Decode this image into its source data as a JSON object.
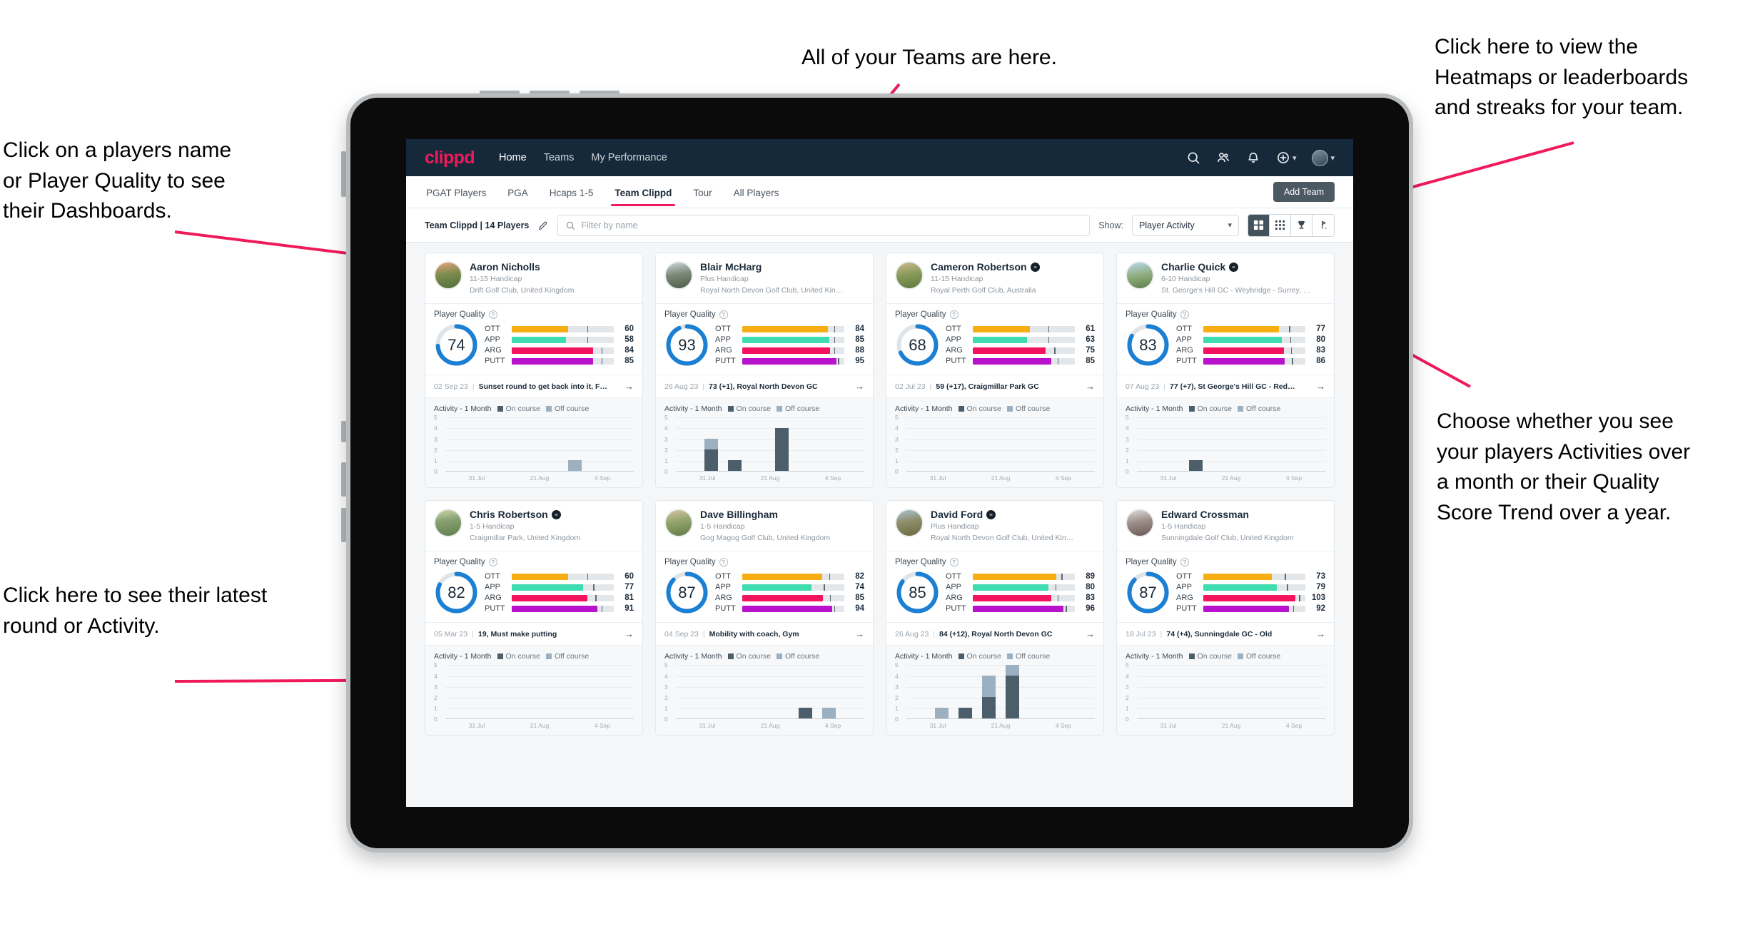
{
  "annotations": [
    {
      "id": "teams-note",
      "text": "All of your Teams are here."
    },
    {
      "id": "heatmaps-note",
      "text": "Click here to view the\nHeatmaps or leaderboards\nand streaks for your team."
    },
    {
      "id": "dashboard-note",
      "text": "Click on a players name\nor Player Quality to see\ntheir Dashboards."
    },
    {
      "id": "activity-note",
      "text": "Choose whether you see\nyour players Activities over\na month or their Quality\nScore Trend over a year."
    },
    {
      "id": "round-note",
      "text": "Click here to see their latest\nround or Activity."
    }
  ],
  "colors": {
    "accent": "#ef1a5b",
    "navbar": "#16293a",
    "ott": "#f6ae13",
    "app": "#3edcb0",
    "arg": "#f4135e",
    "putt": "#b812cc",
    "ring": "#1b7fd4",
    "on_course": "#4d5e6b",
    "off_course": "#9bb0c1"
  },
  "navbar": {
    "brand": "clippd",
    "links": [
      {
        "label": "Home",
        "active": true
      },
      {
        "label": "Teams",
        "active": false
      },
      {
        "label": "My Performance",
        "active": false
      }
    ],
    "icons": [
      "search-icon",
      "people-icon",
      "bell-icon",
      "plus-circle-icon",
      "avatar"
    ]
  },
  "tabs": [
    {
      "label": "PGAT Players",
      "active": false
    },
    {
      "label": "PGA",
      "active": false
    },
    {
      "label": "Hcaps 1-5",
      "active": false
    },
    {
      "label": "Team Clippd",
      "active": true
    },
    {
      "label": "Tour",
      "active": false
    },
    {
      "label": "All Players",
      "active": false
    }
  ],
  "add_team_label": "Add Team",
  "filter_bar": {
    "team_label": "Team Clippd | 14 Players",
    "edit_icon": "pencil-icon",
    "search_placeholder": "Filter by name",
    "search_value": "",
    "show_label": "Show:",
    "show_value": "Player Activity",
    "show_options": [
      "Player Activity",
      "Quality Score Trend"
    ],
    "view_buttons": [
      {
        "icon": "grid-view-icon",
        "active": true
      },
      {
        "icon": "dense-grid-view-icon",
        "active": false
      },
      {
        "icon": "trophy-view-icon",
        "active": false
      },
      {
        "icon": "golf-flag-view-icon",
        "active": false
      }
    ]
  },
  "card_labels": {
    "player_quality": "Player Quality",
    "activity": "Activity - 1 Month",
    "on_course": "On course",
    "off_course": "Off course",
    "help_icon": "help-circle-icon",
    "arrow_icon": "arrow-right-icon"
  },
  "chart_data": {
    "type": "bar",
    "title": "Activity - 1 Month",
    "xlabel": "",
    "ylabel": "",
    "ylim": [
      0,
      5
    ],
    "yticks": [
      0,
      1,
      2,
      3,
      4,
      5
    ],
    "xticks": [
      "31 Jul",
      "21 Aug",
      "4 Sep"
    ],
    "legend": [
      "On course",
      "Off course"
    ],
    "legend_position": "top",
    "grid": true,
    "bins": 8
  },
  "players": [
    {
      "name": "Aaron Nicholls",
      "verified": false,
      "handicap": "11-15 Handicap",
      "club": "Drift Golf Club, United Kingdom",
      "avatar": "linear-gradient(170deg,#e8a37b 0%,#7d8c4e 45%,#4e6e3a 100%)",
      "quality": 74,
      "metrics": [
        {
          "label": "OTT",
          "value": 60,
          "fill": 55,
          "tick": 74
        },
        {
          "label": "APP",
          "value": 58,
          "fill": 53,
          "tick": 74
        },
        {
          "label": "ARG",
          "value": 84,
          "fill": 80,
          "tick": 88
        },
        {
          "label": "PUTT",
          "value": 85,
          "fill": 80,
          "tick": 88
        }
      ],
      "round_date": "02 Sep 23",
      "round_text": "Sunset round to get back into it, F…",
      "activity": [
        {
          "on": 0,
          "off": 0
        },
        {
          "on": 0,
          "off": 0
        },
        {
          "on": 0,
          "off": 0
        },
        {
          "on": 0,
          "off": 0
        },
        {
          "on": 0,
          "off": 0
        },
        {
          "on": 0,
          "off": 1
        },
        {
          "on": 0,
          "off": 0
        },
        {
          "on": 0,
          "off": 0
        }
      ]
    },
    {
      "name": "Blair McHarg",
      "verified": false,
      "handicap": "Plus Handicap",
      "club": "Royal North Devon Golf Club, United Kin…",
      "avatar": "linear-gradient(170deg,#cfd8dd 0%,#7d8a78 45%,#4c5a46 100%)",
      "quality": 93,
      "metrics": [
        {
          "label": "OTT",
          "value": 84,
          "fill": 84,
          "tick": 90
        },
        {
          "label": "APP",
          "value": 85,
          "fill": 85,
          "tick": 90
        },
        {
          "label": "ARG",
          "value": 88,
          "fill": 86,
          "tick": 90
        },
        {
          "label": "PUTT",
          "value": 95,
          "fill": 92,
          "tick": 94
        }
      ],
      "round_date": "26 Aug 23",
      "round_text": "73 (+1), Royal North Devon GC",
      "activity": [
        {
          "on": 0,
          "off": 0
        },
        {
          "on": 2,
          "off": 1
        },
        {
          "on": 1,
          "off": 0
        },
        {
          "on": 0,
          "off": 0
        },
        {
          "on": 4,
          "off": 0
        },
        {
          "on": 0,
          "off": 0
        },
        {
          "on": 0,
          "off": 0
        },
        {
          "on": 0,
          "off": 0
        }
      ]
    },
    {
      "name": "Cameron Robertson",
      "verified": true,
      "handicap": "11-15 Handicap",
      "club": "Royal Perth Golf Club, Australia",
      "avatar": "linear-gradient(170deg,#cdbb8e 0%,#8a9a5a 45%,#5f7a3e 100%)",
      "quality": 68,
      "metrics": [
        {
          "label": "OTT",
          "value": 61,
          "fill": 56,
          "tick": 74
        },
        {
          "label": "APP",
          "value": 63,
          "fill": 53,
          "tick": 74
        },
        {
          "label": "ARG",
          "value": 75,
          "fill": 71,
          "tick": 80
        },
        {
          "label": "PUTT",
          "value": 85,
          "fill": 77,
          "tick": 83
        }
      ],
      "round_date": "02 Jul 23",
      "round_text": "59 (+17), Craigmillar Park GC",
      "activity": [
        {
          "on": 0,
          "off": 0
        },
        {
          "on": 0,
          "off": 0
        },
        {
          "on": 0,
          "off": 0
        },
        {
          "on": 0,
          "off": 0
        },
        {
          "on": 0,
          "off": 0
        },
        {
          "on": 0,
          "off": 0
        },
        {
          "on": 0,
          "off": 0
        },
        {
          "on": 0,
          "off": 0
        }
      ]
    },
    {
      "name": "Charlie Quick",
      "verified": true,
      "handicap": "6-10 Handicap",
      "club": "St. George's Hill GC - Weybridge - Surrey, …",
      "avatar": "linear-gradient(170deg,#b9d7ea 0%,#8fae7c 50%,#5d7d4b 100%)",
      "quality": 83,
      "metrics": [
        {
          "label": "OTT",
          "value": 77,
          "fill": 74,
          "tick": 84
        },
        {
          "label": "APP",
          "value": 80,
          "fill": 77,
          "tick": 85
        },
        {
          "label": "ARG",
          "value": 83,
          "fill": 79,
          "tick": 86
        },
        {
          "label": "PUTT",
          "value": 86,
          "fill": 80,
          "tick": 87
        }
      ],
      "round_date": "07 Aug 23",
      "round_text": "77 (+7), St George's Hill GC - Red…",
      "activity": [
        {
          "on": 0,
          "off": 0
        },
        {
          "on": 0,
          "off": 0
        },
        {
          "on": 1,
          "off": 0
        },
        {
          "on": 0,
          "off": 0
        },
        {
          "on": 0,
          "off": 0
        },
        {
          "on": 0,
          "off": 0
        },
        {
          "on": 0,
          "off": 0
        },
        {
          "on": 0,
          "off": 0
        }
      ]
    },
    {
      "name": "Chris Robertson",
      "verified": true,
      "handicap": "1-5 Handicap",
      "club": "Craigmillar Park, United Kingdom",
      "avatar": "linear-gradient(170deg,#c9d9a8 0%,#8aa173 40%,#5f7f4d 100%)",
      "quality": 82,
      "metrics": [
        {
          "label": "OTT",
          "value": 60,
          "fill": 55,
          "tick": 74
        },
        {
          "label": "APP",
          "value": 77,
          "fill": 70,
          "tick": 80
        },
        {
          "label": "ARG",
          "value": 81,
          "fill": 74,
          "tick": 82
        },
        {
          "label": "PUTT",
          "value": 91,
          "fill": 84,
          "tick": 88
        }
      ],
      "round_date": "05 Mar 23",
      "round_text": "19, Must make putting",
      "activity": [
        {
          "on": 0,
          "off": 0
        },
        {
          "on": 0,
          "off": 0
        },
        {
          "on": 0,
          "off": 0
        },
        {
          "on": 0,
          "off": 0
        },
        {
          "on": 0,
          "off": 0
        },
        {
          "on": 0,
          "off": 0
        },
        {
          "on": 0,
          "off": 0
        },
        {
          "on": 0,
          "off": 0
        }
      ]
    },
    {
      "name": "Dave Billingham",
      "verified": false,
      "handicap": "1-5 Handicap",
      "club": "Gog Magog Golf Club, United Kingdom",
      "avatar": "linear-gradient(170deg,#d8c4a4 0%,#97a86f 40%,#5e7b48 100%)",
      "quality": 87,
      "metrics": [
        {
          "label": "OTT",
          "value": 82,
          "fill": 78,
          "tick": 85
        },
        {
          "label": "APP",
          "value": 74,
          "fill": 68,
          "tick": 80
        },
        {
          "label": "ARG",
          "value": 85,
          "fill": 79,
          "tick": 86
        },
        {
          "label": "PUTT",
          "value": 94,
          "fill": 88,
          "tick": 90
        }
      ],
      "round_date": "04 Sep 23",
      "round_text": "Mobility with coach, Gym",
      "activity": [
        {
          "on": 0,
          "off": 0
        },
        {
          "on": 0,
          "off": 0
        },
        {
          "on": 0,
          "off": 0
        },
        {
          "on": 0,
          "off": 0
        },
        {
          "on": 0,
          "off": 0
        },
        {
          "on": 1,
          "off": 0
        },
        {
          "on": 0,
          "off": 1
        },
        {
          "on": 0,
          "off": 0
        }
      ]
    },
    {
      "name": "David Ford",
      "verified": true,
      "handicap": "Plus Handicap",
      "club": "Royal North Devon Golf Club, United Kin…",
      "avatar": "linear-gradient(170deg,#a9c3d4 0%,#8d8d67 45%,#6d6a45 100%)",
      "quality": 85,
      "metrics": [
        {
          "label": "OTT",
          "value": 89,
          "fill": 82,
          "tick": 87
        },
        {
          "label": "APP",
          "value": 80,
          "fill": 74,
          "tick": 81
        },
        {
          "label": "ARG",
          "value": 83,
          "fill": 77,
          "tick": 83
        },
        {
          "label": "PUTT",
          "value": 96,
          "fill": 89,
          "tick": 91
        }
      ],
      "round_date": "26 Aug 23",
      "round_text": "84 (+12), Royal North Devon GC",
      "activity": [
        {
          "on": 0,
          "off": 0
        },
        {
          "on": 0,
          "off": 1
        },
        {
          "on": 1,
          "off": 0
        },
        {
          "on": 2,
          "off": 2
        },
        {
          "on": 4,
          "off": 1
        },
        {
          "on": 0,
          "off": 0
        },
        {
          "on": 0,
          "off": 0
        },
        {
          "on": 0,
          "off": 0
        }
      ]
    },
    {
      "name": "Edward Crossman",
      "verified": false,
      "handicap": "1-5 Handicap",
      "club": "Sunningdale Golf Club, United Kingdom",
      "avatar": "linear-gradient(170deg,#dcdcdc 0%,#9e8f8a 45%,#6a5a57 100%)",
      "quality": 87,
      "metrics": [
        {
          "label": "OTT",
          "value": 73,
          "fill": 67,
          "tick": 80
        },
        {
          "label": "APP",
          "value": 79,
          "fill": 72,
          "tick": 82
        },
        {
          "label": "ARG",
          "value": 103,
          "fill": 90,
          "tick": 94
        },
        {
          "label": "PUTT",
          "value": 92,
          "fill": 84,
          "tick": 88
        }
      ],
      "round_date": "18 Jul 23",
      "round_text": "74 (+4), Sunningdale GC - Old",
      "activity": [
        {
          "on": 0,
          "off": 0
        },
        {
          "on": 0,
          "off": 0
        },
        {
          "on": 0,
          "off": 0
        },
        {
          "on": 0,
          "off": 0
        },
        {
          "on": 0,
          "off": 0
        },
        {
          "on": 0,
          "off": 0
        },
        {
          "on": 0,
          "off": 0
        },
        {
          "on": 0,
          "off": 0
        }
      ]
    }
  ]
}
